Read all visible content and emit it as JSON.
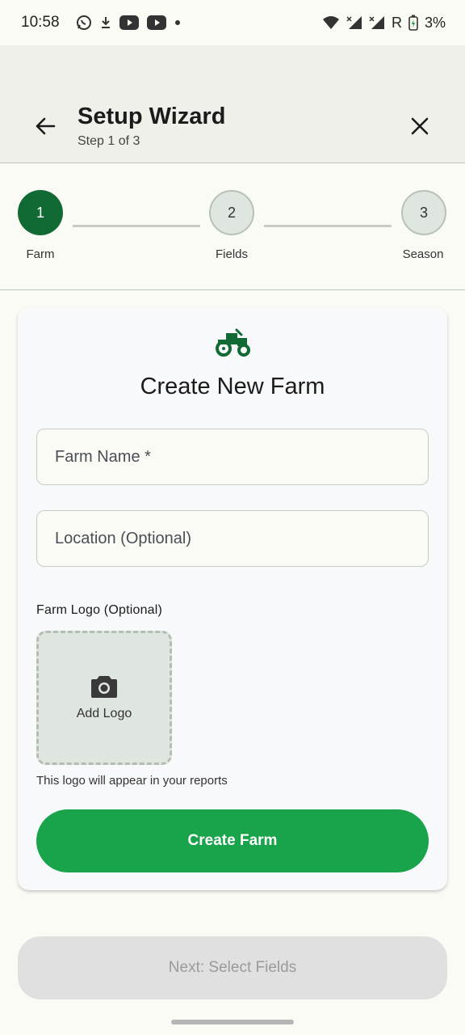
{
  "status_bar": {
    "time": "10:58",
    "left_icons": [
      "whatsapp-icon",
      "download-icon",
      "youtube-icon",
      "youtube-icon",
      "dot-icon"
    ],
    "right_icons": [
      "wifi-icon",
      "signal-icon",
      "signal-icon"
    ],
    "roaming": "R",
    "battery": "3%"
  },
  "app_bar": {
    "title": "Setup Wizard",
    "subtitle": "Step 1 of 3"
  },
  "stepper": {
    "steps": [
      {
        "number": "1",
        "label": "Farm",
        "active": true
      },
      {
        "number": "2",
        "label": "Fields",
        "active": false
      },
      {
        "number": "3",
        "label": "Season",
        "active": false
      }
    ]
  },
  "card": {
    "icon": "tractor-icon",
    "title": "Create New Farm",
    "farm_name_placeholder": "Farm Name *",
    "location_placeholder": "Location (Optional)",
    "logo_label": "Farm Logo (Optional)",
    "add_logo_label": "Add Logo",
    "logo_hint": "This logo will appear in your reports",
    "create_button": "Create Farm"
  },
  "footer": {
    "next_button": "Next: Select Fields"
  },
  "colors": {
    "primary": "#116a34",
    "button": "#19a34a",
    "disabled": "#e0e0e0"
  }
}
